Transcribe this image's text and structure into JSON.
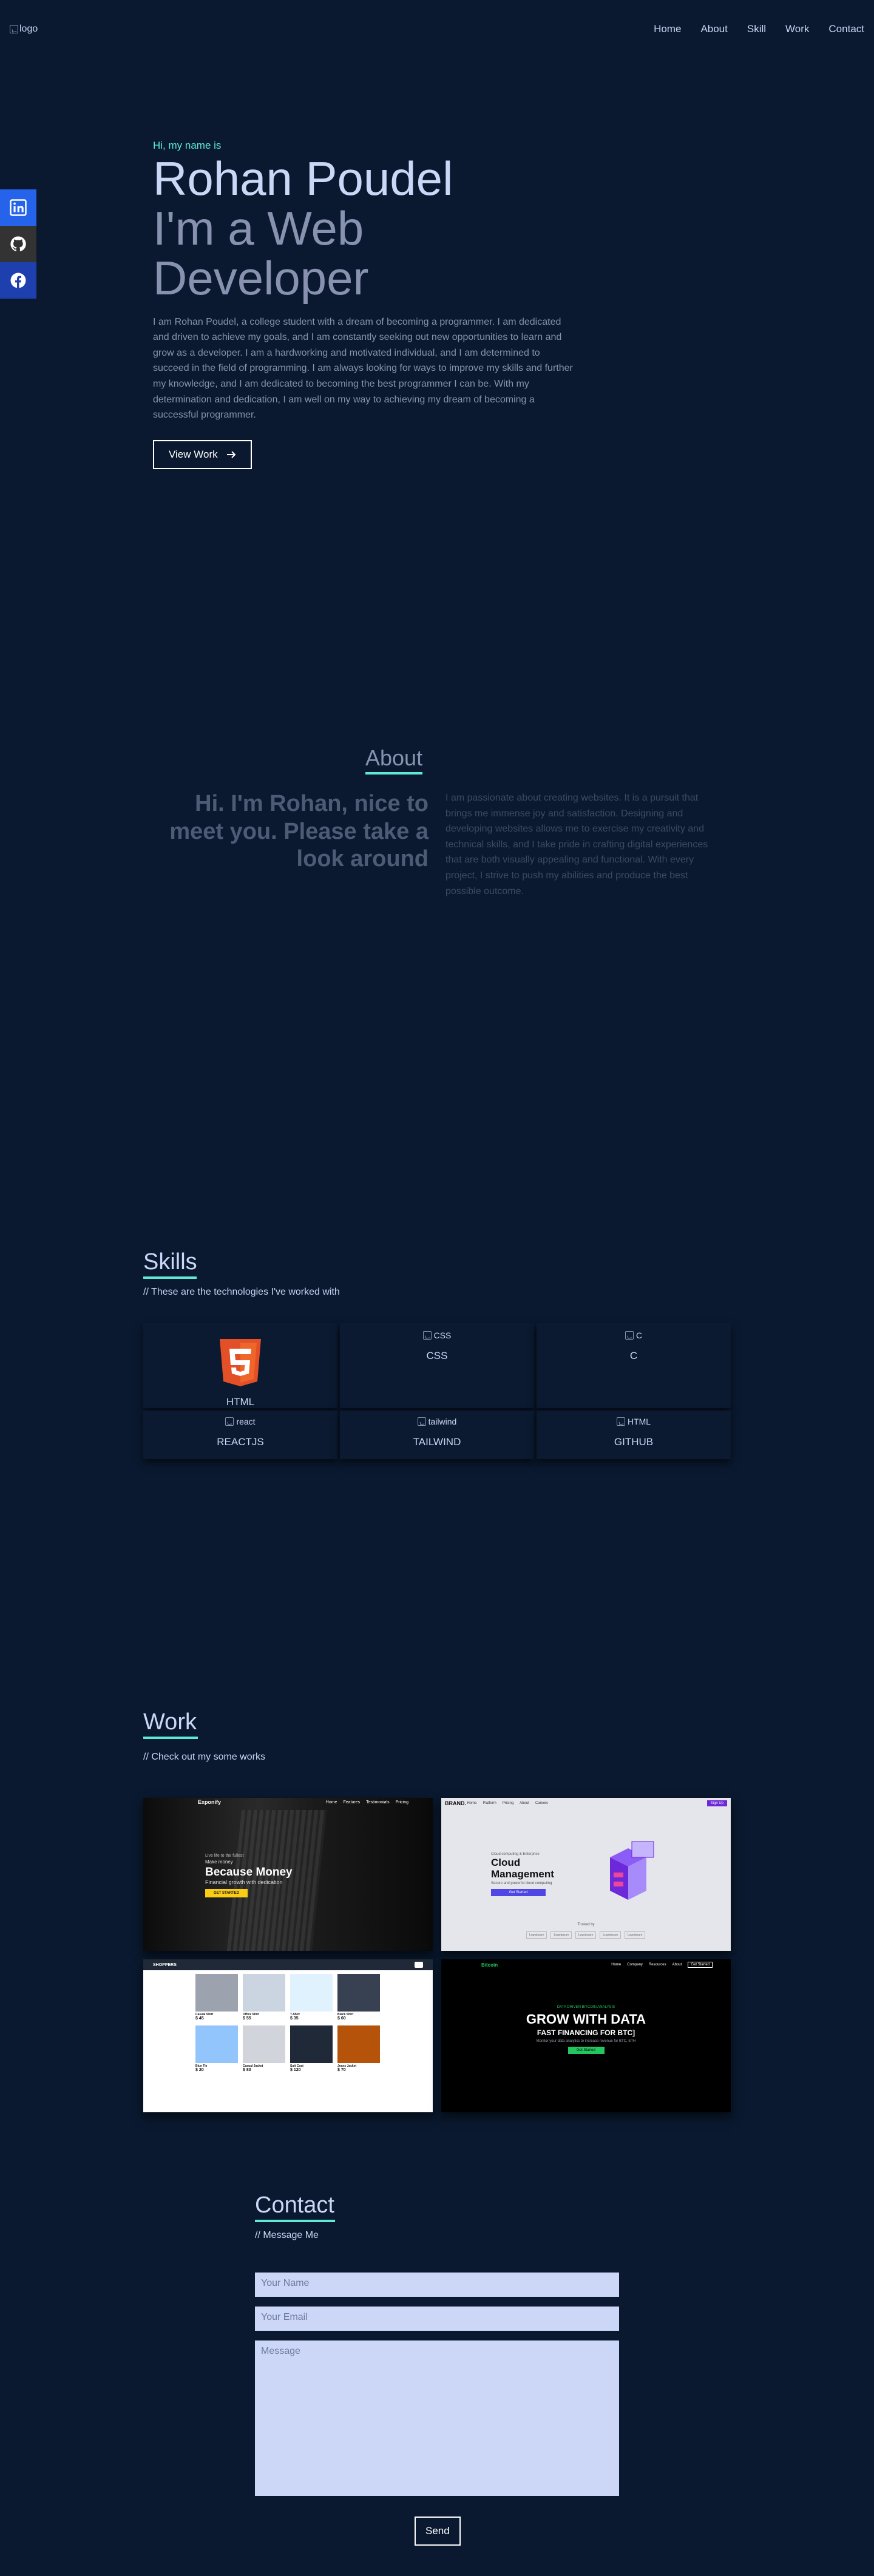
{
  "nav": {
    "logo_alt": "logo",
    "links": [
      "Home",
      "About",
      "Skill",
      "Work",
      "Contact"
    ]
  },
  "social": [
    "linkedin-icon",
    "github-icon",
    "facebook-icon"
  ],
  "hero": {
    "greeting": "Hi, my name is",
    "name": "Rohan Poudel",
    "role": "I'm a Web Developer",
    "bio": "I am Rohan Poudel, a college student with a dream of becoming a programmer. I am dedicated and driven to achieve my goals, and I am constantly seeking out new opportunities to learn and grow as a developer. I am a hardworking and motivated individual, and I am determined to succeed in the field of programming. I am always looking for ways to improve my skills and further my knowledge, and I am dedicated to becoming the best programmer I can be. With my determination and dedication, I am well on my way to achieving my dream of becoming a successful programmer.",
    "cta": "View Work",
    "cta_icon": "arrow-right-icon"
  },
  "about": {
    "title": "About",
    "intro": "Hi. I'm Rohan, nice to meet you. Please take a look around",
    "text": "I am passionate about creating websites. It is a pursuit that brings me immense joy and satisfaction. Designing and developing websites allows me to exercise my creativity and technical skills, and I take pride in crafting digital experiences that are both visually appealing and functional. With every project, I strive to push my abilities and produce the best possible outcome."
  },
  "skills": {
    "title": "Skills",
    "subtitle": "// These are the technologies I've worked with",
    "items": [
      {
        "label": "HTML",
        "alt": ""
      },
      {
        "label": "CSS",
        "alt": "CSS"
      },
      {
        "label": "C",
        "alt": "C"
      },
      {
        "label": "REACTJS",
        "alt": "react"
      },
      {
        "label": "TAILWIND",
        "alt": "tailwind"
      },
      {
        "label": "GITHUB",
        "alt": "HTML"
      }
    ]
  },
  "work": {
    "title": "Work",
    "subtitle": "// Check out my some works",
    "projects": [
      {
        "brand": "Exponify",
        "nav": [
          "Home",
          "Features",
          "Testimonials",
          "Pricing"
        ],
        "small": "Live life to the fullest",
        "kicker": "Make money",
        "headline": "Because Money",
        "sub": "Financial growth with dedication",
        "button": "GET STARTED"
      },
      {
        "brand": "BRAND.",
        "nav": [
          "Home",
          "Platform",
          "Pricing",
          "About",
          "Careers"
        ],
        "button_top": "Sign Up",
        "kicker": "Cloud computing & Enterprise",
        "headline": "Cloud Management",
        "sub": "Secure and powerful cloud computing",
        "button": "Get Started",
        "logos_label": "Trusted by",
        "logos": [
          "Logoipsum",
          "Logoipsum",
          "Logoipsum",
          "Logoipsum",
          "Logoipsum"
        ]
      },
      {
        "brand": "SHOPPERS",
        "products": [
          {
            "name": "Casual Shirt",
            "price": "$ 45"
          },
          {
            "name": "Office Shirt",
            "price": "$ 55"
          },
          {
            "name": "T-Shirt",
            "price": "$ 35"
          },
          {
            "name": "Black Shirt",
            "price": "$ 60"
          },
          {
            "name": "Blue Tie",
            "price": "$ 20"
          },
          {
            "name": "Casual Jacket",
            "price": "$ 80"
          },
          {
            "name": "Suit Coat",
            "price": "$ 120"
          },
          {
            "name": "Jeans Jacket",
            "price": "$ 70"
          }
        ]
      },
      {
        "brand": "Bitcoin",
        "nav": [
          "Home",
          "Company",
          "Resources",
          "About"
        ],
        "button_top": "Get Started",
        "kicker": "DATA DRIVEN BITCOIN ANALYSIS",
        "headline": "GROW WITH DATA",
        "sub": "FAST FINANCING FOR BTC]",
        "desc": "Monitor your data analytics to increase revenue for BTC, ETH",
        "button": "Get Started"
      }
    ]
  },
  "contact": {
    "title": "Contact",
    "subtitle": "// Message Me",
    "name_placeholder": "Your Name",
    "email_placeholder": "Your Email",
    "message_placeholder": "Message",
    "send": "Send"
  },
  "colors": {
    "bg": "#0a192f",
    "accent": "#5eead4",
    "heading": "#ccd6f6",
    "muted": "#8892b0"
  }
}
